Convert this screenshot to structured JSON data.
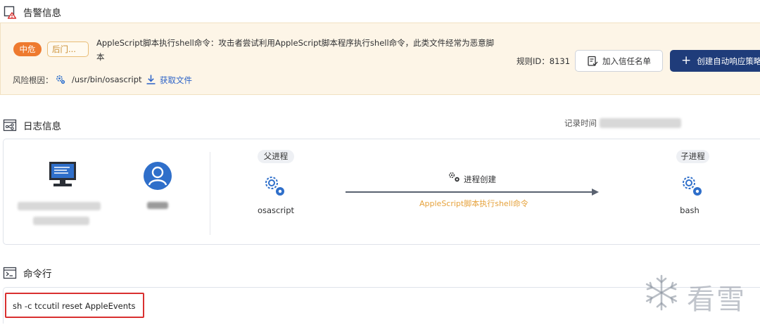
{
  "alert_section": {
    "title": "告警信息",
    "severity_tag": "中危",
    "category_tag": "后门...",
    "description": "AppleScript脚本执行shell命令：攻击者尝试利用AppleScript脚本程序执行shell命令，此类文件经常为恶意脚本",
    "root_cause_label": "风险根因：",
    "root_cause_path": "/usr/bin/osascript",
    "download_link": "获取文件",
    "rule_id_text": "规则ID：8131",
    "trust_button": "加入信任名单",
    "create_button": "创建自动响应策略"
  },
  "log_section": {
    "title": "日志信息",
    "record_time_label": "记录时间",
    "parent_label": "父进程",
    "parent_name": "osascript",
    "child_label": "子进程",
    "child_name": "bash",
    "relation_label": "进程创建",
    "relation_desc": "AppleScript脚本执行shell命令"
  },
  "command_section": {
    "title": "命令行",
    "command": "sh -c tccutil reset AppleEvents"
  },
  "watermark": {
    "text": "看雪"
  },
  "colors": {
    "severity": "#ee7a2f",
    "primary_button": "#1f3c7a",
    "link": "#2a61c7",
    "highlight_border": "#d93030",
    "relation_desc": "#e6a23c"
  }
}
